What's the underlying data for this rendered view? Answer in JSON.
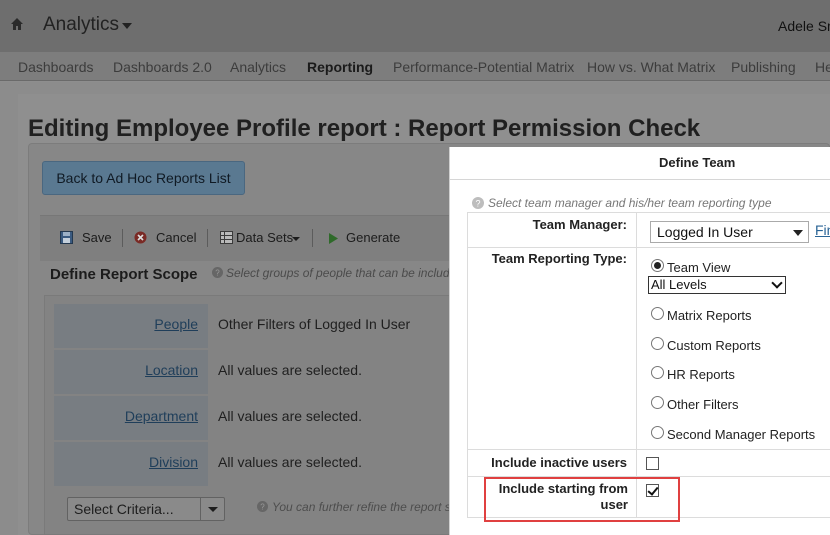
{
  "header": {
    "app_title": "Analytics",
    "user_name": "Adele Sm"
  },
  "nav": {
    "items": [
      {
        "label": "Dashboards",
        "active": false
      },
      {
        "label": "Dashboards 2.0",
        "active": false
      },
      {
        "label": "Analytics",
        "active": false
      },
      {
        "label": "Reporting",
        "active": true
      },
      {
        "label": "Performance-Potential Matrix",
        "active": false
      },
      {
        "label": "How vs. What Matrix",
        "active": false
      },
      {
        "label": "Publishing",
        "active": false
      },
      {
        "label": "He",
        "active": false
      }
    ]
  },
  "page": {
    "title": "Editing Employee Profile report : Report Permission Check",
    "back_button": "Back to Ad Hoc Reports List",
    "toolbar": {
      "save": "Save",
      "cancel": "Cancel",
      "data_sets": "Data Sets",
      "generate": "Generate"
    },
    "scope": {
      "title": "Define Report Scope",
      "hint": "Select groups of people that can be include",
      "rows": [
        {
          "label": "People",
          "value": "Other Filters of Logged In User"
        },
        {
          "label": "Location",
          "value": "All values are selected."
        },
        {
          "label": "Department",
          "value": "All values are selected."
        },
        {
          "label": "Division",
          "value": "All values are selected."
        }
      ],
      "select_criteria": "Select Criteria...",
      "refine_hint": "You can further refine the report s"
    }
  },
  "modal": {
    "title": "Define Team",
    "hint": "Select team manager and his/her team reporting type",
    "team_manager_label": "Team Manager:",
    "team_manager_value": "Logged In User",
    "find_link": "Fin",
    "team_reporting_label": "Team Reporting Type:",
    "team_view": "Team View",
    "levels_value": "All Levels",
    "options": [
      "Matrix Reports",
      "Custom Reports",
      "HR Reports",
      "Other Filters",
      "Second Manager Reports"
    ],
    "include_inactive_label": "Include inactive users",
    "include_inactive_checked": false,
    "include_starting_label_line1": "Include starting from",
    "include_starting_label_line2": "user",
    "include_starting_checked": true,
    "highlight_color": "#e04040"
  },
  "colors": {
    "overlay": "#8e8e8e",
    "link": "#2a6496"
  }
}
